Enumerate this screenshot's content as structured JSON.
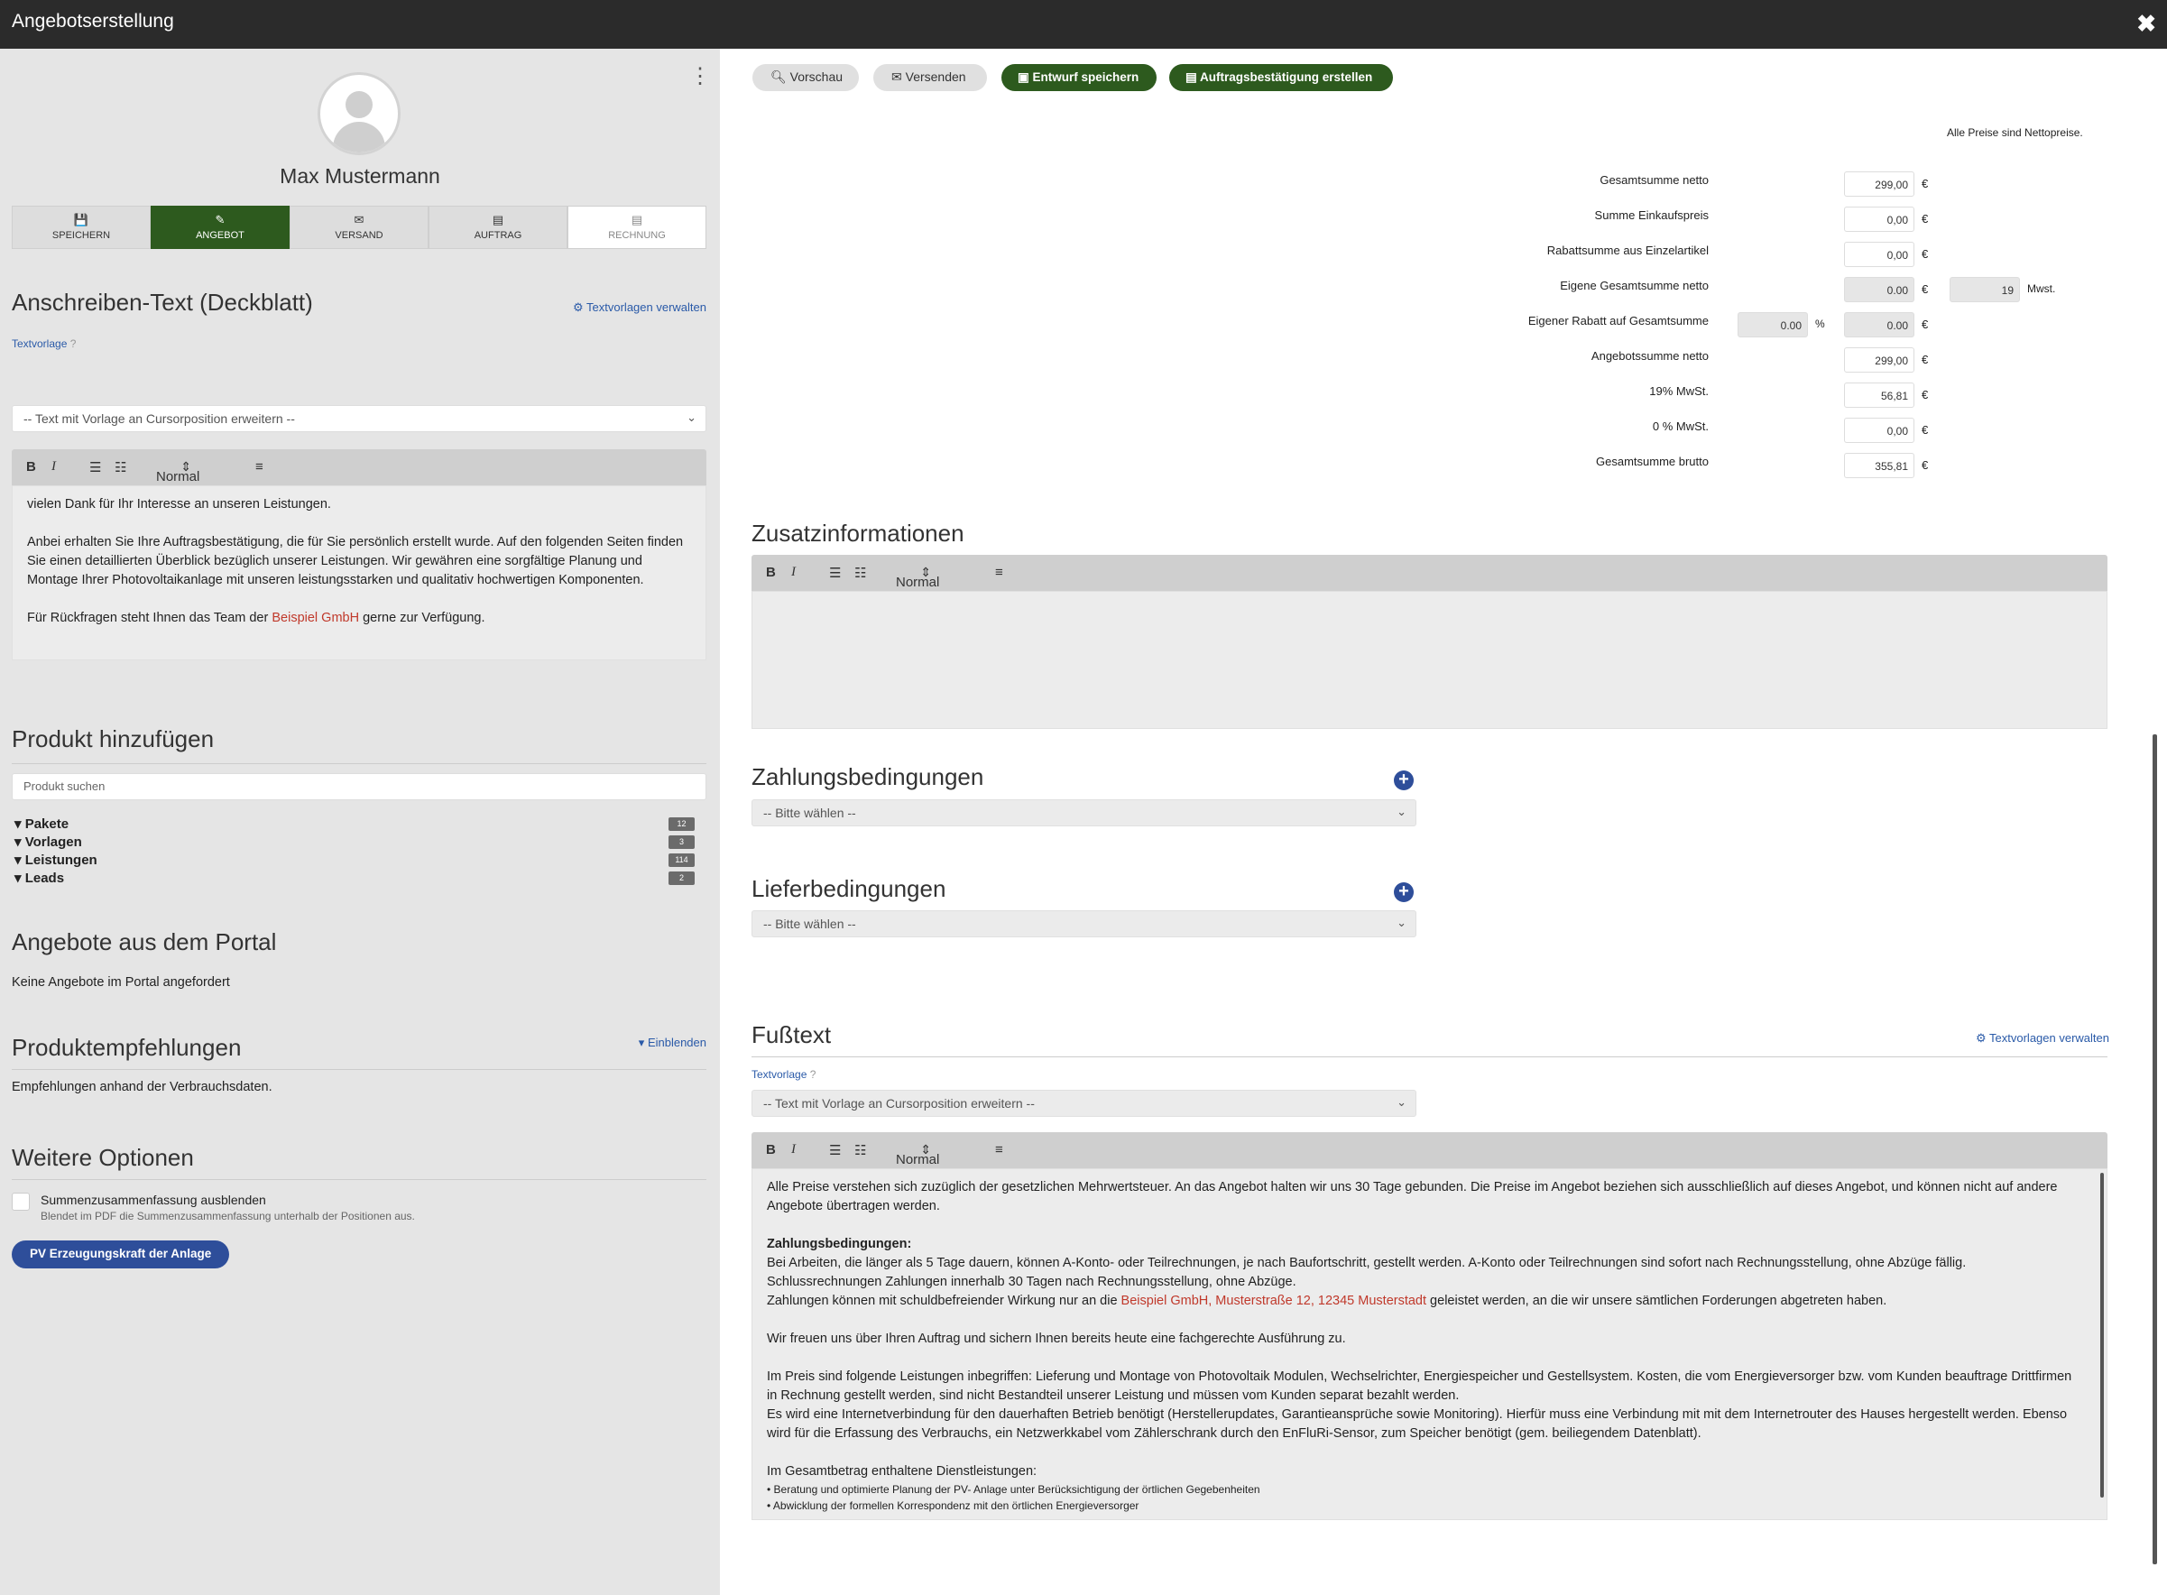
{
  "window": {
    "title": "Angebotserstellung",
    "close": "✖"
  },
  "user": {
    "name": "Max Mustermann"
  },
  "steps": [
    {
      "label": "SPEICHERN",
      "icon": "💾"
    },
    {
      "label": "ANGEBOT",
      "icon": "✎"
    },
    {
      "label": "VERSAND",
      "icon": "✉"
    },
    {
      "label": "AUFTRAG",
      "icon": "▤"
    },
    {
      "label": "RECHNUNG",
      "icon": "▤"
    }
  ],
  "cover": {
    "title": "Anschreiben-Text (Deckblatt)",
    "manage_link": "Textvorlagen verwalten",
    "template_label": "Textvorlage",
    "template_select": "-- Text mit Vorlage an Cursorposition erweitern --",
    "format": "Normal",
    "text1": "vielen Dank für Ihr Interesse an unseren Leistungen.",
    "text2": "Anbei erhalten Sie Ihre Auftragsbestätigung, die für Sie persönlich erstellt wurde. Auf den folgenden Seiten finden Sie einen detaillierten Überblick bezüglich unserer Leistungen. Wir gewähren eine sorgfältige Planung und Montage Ihrer Photovoltaikanlage mit unseren leistungsstarken und qualitativ hochwertigen Komponenten.",
    "text3a": "Für Rückfragen steht Ihnen das Team der ",
    "text3b": "Beispiel GmbH",
    "text3c": " gerne zur Verfügung."
  },
  "product": {
    "title": "Produkt hinzufügen",
    "search_placeholder": "Produkt suchen",
    "tree": [
      {
        "label": "Pakete",
        "count": "12"
      },
      {
        "label": "Vorlagen",
        "count": "3"
      },
      {
        "label": "Leistungen",
        "count": "114"
      },
      {
        "label": "Leads",
        "count": "2"
      }
    ]
  },
  "portal": {
    "title": "Angebote aus dem Portal",
    "text": "Keine Angebote im Portal angefordert"
  },
  "recommend": {
    "title": "Produktempfehlungen",
    "toggle": "Einblenden",
    "text": "Empfehlungen anhand der Verbrauchsdaten."
  },
  "options": {
    "title": "Weitere Optionen",
    "checkbox_label": "Summenzusammenfassung ausblenden",
    "checkbox_help": "Blendet im PDF die Summenzusammenfassung unterhalb der Positionen aus.",
    "pv_button": "PV Erzeugungskraft der Anlage"
  },
  "toolbar": {
    "preview": "Vorschau",
    "send": "Versenden",
    "save_draft": "Entwurf speichern",
    "create_confirmation": "Auftragsbestätigung erstellen"
  },
  "totals": {
    "note": "Alle Preise sind Nettopreise.",
    "currency": "€",
    "percent": "%",
    "vat_label": "Mwst.",
    "rows": [
      {
        "label": "Gesamtsumme netto",
        "value": "299,00"
      },
      {
        "label": "Summe Einkaufspreis",
        "value": "0,00"
      },
      {
        "label": "Rabattsumme aus Einzelartikel",
        "value": "0,00"
      },
      {
        "label": "Eigene Gesamtsumme netto",
        "value": "0.00",
        "vat": "19"
      },
      {
        "label": "Eigener Rabatt auf Gesamtsumme",
        "value": "0.00",
        "percent_value": "0.00"
      },
      {
        "label": "Angebotssumme netto",
        "value": "299,00"
      },
      {
        "label": "19% MwSt.",
        "value": "56,81"
      },
      {
        "label": "0 % MwSt.",
        "value": "0,00"
      },
      {
        "label": "Gesamtsumme brutto",
        "value": "355,81"
      }
    ]
  },
  "extra": {
    "title": "Zusatzinformationen",
    "format": "Normal"
  },
  "payment": {
    "title": "Zahlungsbedingungen",
    "select": "-- Bitte wählen --"
  },
  "delivery": {
    "title": "Lieferbedingungen",
    "select": "-- Bitte wählen --"
  },
  "footer": {
    "title": "Fußtext",
    "manage_link": "Textvorlagen verwalten",
    "template_label": "Textvorlage",
    "template_select": "-- Text mit Vorlage an Cursorposition erweitern --",
    "format": "Normal",
    "p1": "Alle Preise verstehen sich zuzüglich der gesetzlichen Mehrwertsteuer. An das Angebot halten wir uns 30 Tage gebunden. Die Preise im Angebot beziehen sich ausschließlich auf dieses Angebot, und können nicht auf andere Angebote übertragen werden.",
    "pay_heading": "Zahlungsbedingungen:",
    "pay1": "Bei Arbeiten, die länger als 5 Tage dauern, können A-Konto- oder Teilrechnungen, je nach Baufortschritt, gestellt werden. A-Konto oder Teilrechnungen sind sofort nach Rechnungsstellung, ohne Abzüge fällig.",
    "pay2": "Schlussrechnungen Zahlungen innerhalb 30 Tagen nach Rechnungsstellung, ohne Abzüge.",
    "pay3a": "Zahlungen können mit schuldbefreiender Wirkung nur an die ",
    "pay3b": "Beispiel GmbH, Musterstraße 12, 12345 Musterstadt",
    "pay3c": " geleistet werden, an die wir unsere sämtlichen Forderungen abgetreten haben.",
    "p3": "Wir freuen uns über Ihren Auftrag und sichern Ihnen bereits heute eine fachgerechte Ausführung zu.",
    "p4a": "Im Preis sind folgende Leistungen inbegriffen: Lieferung und Montage von Photovoltaik Modulen, Wechselrichter, Energiespeicher und Gestellsystem. Kosten, die vom Energieversorger bzw. vom Kunden beauftrage Drittfirmen in Rechnung gestellt werden, sind nicht Bestandteil unserer Leistung und müssen vom Kunden separat bezahlt werden.",
    "p4b": "Es wird eine Internetverbindung für den dauerhaften Betrieb benötigt (Herstellerupdates, Garantieansprüche sowie Monitoring). Hierfür muss eine Verbindung mit mit dem Internetrouter des Hauses hergestellt werden. Ebenso wird für die Erfassung des Verbrauchs, ein Netzwerkkabel vom Zählerschrank durch den EnFluRi-Sensor, zum Speicher benötigt (gem. beiliegendem Datenblatt).",
    "p5": "Im Gesamtbetrag enthaltene Dienstleistungen:",
    "b1": "• Beratung und optimierte Planung der PV- Anlage unter Berücksichtigung der örtlichen Gegebenheiten",
    "b2": "• Abwicklung der formellen Korrespondenz mit den örtlichen Energieversorger"
  }
}
